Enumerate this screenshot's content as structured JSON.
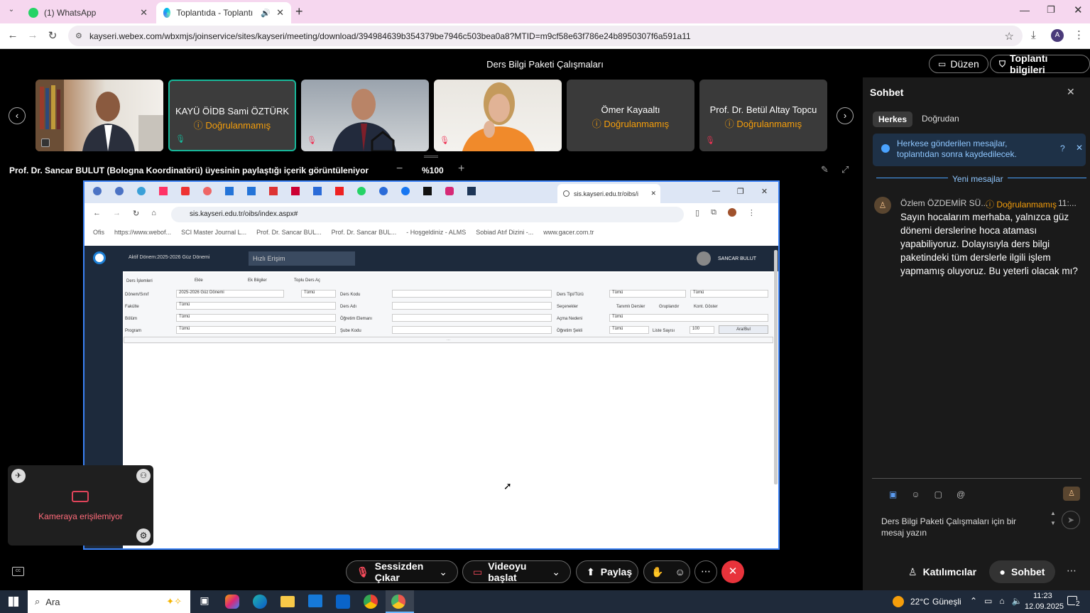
{
  "browser": {
    "tabs": [
      {
        "title": "(1) WhatsApp"
      },
      {
        "title": "Toplantıda - Toplantı - Webe"
      }
    ],
    "url": "kayseri.webex.com/wbxmjs/joinservice/sites/kayseri/meeting/download/394984639b354379be7946c503bea0a8?MTID=m9cf58e63f786e24b8950307f6a591a11",
    "profile_initial": "A"
  },
  "meeting": {
    "title": "Ders Bilgi Paketi Çalışmaları",
    "layout_button": "Düzen",
    "info_button": "Toplantı bilgileri",
    "participants": [
      {
        "name": "",
        "status": ""
      },
      {
        "name": "KAYÜ ÖİDB Sami ÖZTÜRK",
        "status": "Doğrulanmamış"
      },
      {
        "name": "",
        "status": ""
      },
      {
        "name": "",
        "status": ""
      },
      {
        "name": "Ömer Kayaaltı",
        "status": "Doğrulanmamış"
      },
      {
        "name": "Prof. Dr. Betül Altay Topcu",
        "status": "Doğrulanmamış"
      }
    ],
    "share_caption": "Prof. Dr. Sancar BULUT (Bologna Koordinatörü) üyesinin paylaştığı içerik görüntüleniyor",
    "zoom_level": "%100",
    "self_view": {
      "message": "Kameraya erişilemiyor"
    }
  },
  "shared_screen": {
    "tab_title": "sis.kayseri.edu.tr/oibs/i",
    "url": "sis.kayseri.edu.tr/oibs/index.aspx#",
    "bookmarks": [
      "Ofis",
      "https://www.webof...",
      "SCI Master Journal L...",
      "Prof. Dr. Sancar BUL...",
      "Prof. Dr. Sancar BUL...",
      "- Hoşgeldiniz - ALMS",
      "Sobiad Atıf Dizini -...",
      "www.gacer.com.tr"
    ],
    "app": {
      "term": "Aktif Dönem:2025-2026 Güz Dönemi",
      "search_placeholder": "Hızlı Erişim",
      "user": "SANCAR BULUT",
      "tabs": [
        "Ders İşlemleri",
        "Ekle",
        "Ek Bilgiler",
        "Toplu Ders Aç"
      ],
      "labels": {
        "donem": "Dönem/Sınıf",
        "fakulte": "Fakülte",
        "bolum": "Bölüm",
        "program": "Program",
        "ders_kodu": "Ders Kodu",
        "ders_adi": "Ders Adı",
        "ogretim_elemani": "Öğretim Elemanı",
        "sube_kodu": "Şube Kodu",
        "ders_tipi": "Ders Tipi/Türü",
        "secenekler": "Seçenekler",
        "acma_nedeni": "Açma Nedeni",
        "ogretim_sekli": "Öğretim Şekli",
        "liste_sayisi": "Liste Sayısı"
      },
      "values": {
        "donem": "2025-2026 Güz Dönemi",
        "tumu": "Tümü",
        "liste_sayisi": "100",
        "opt1": "Tanımlı Dersler",
        "opt2": "Gruplandır",
        "opt3": "Kont. Göster",
        "search_btn": "Ara/Bul",
        "footer": "..."
      }
    }
  },
  "chat": {
    "title": "Sohbet",
    "tabs": [
      "Herkes",
      "Doğrudan"
    ],
    "notice": "Herkese gönderilen mesajlar, toplantıdan sonra kaydedilecek.",
    "new_messages": "Yeni mesajlar",
    "message": {
      "sender": "Özlem ÖZDEMİR SÜ...",
      "status": "Doğrulanmamış",
      "time": "11:...",
      "text": "Sayın hocalarım merhaba, yalnızca güz dönemi derslerine hoca ataması yapabiliyoruz. Dolayısıyla ders bilgi paketindeki tüm derslerle ilgili işlem yapmamış oluyoruz. Bu yeterli olacak mı?"
    },
    "input_placeholder": "Ders Bilgi Paketi Çalışmaları için bir mesaj yazın"
  },
  "controls": {
    "unmute": "Sessizden Çıkar",
    "video": "Videoyu başlat",
    "share": "Paylaş",
    "participants": "Katılımcılar",
    "chat": "Sohbet"
  },
  "taskbar": {
    "search": "Ara",
    "weather": "22°C",
    "weather_text": "Güneşli",
    "time": "11:23",
    "date": "12.09.2025",
    "notifications": "2"
  },
  "colors": {
    "accent": "#0f7ad0",
    "end_call": "#e8333b",
    "warning": "#f59e0b",
    "app_nav": "#1d2a3c"
  }
}
